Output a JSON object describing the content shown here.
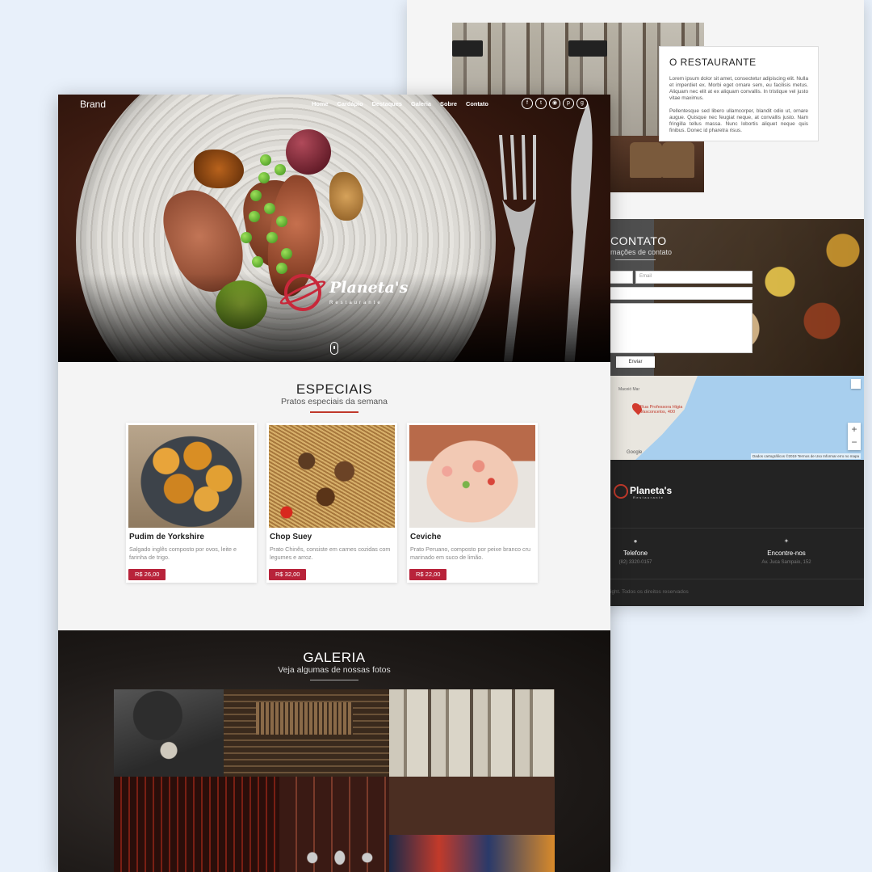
{
  "colors": {
    "accent": "#b8233a",
    "page_bg": "#e8f0fa",
    "dark": "#232323"
  },
  "hero": {
    "brand": "Brand",
    "nav": [
      "Home",
      "Cardápio",
      "Destaques",
      "Galeria",
      "Sobre",
      "Contato"
    ],
    "social_icons": [
      "facebook-icon",
      "twitter-icon",
      "instagram-icon",
      "pinterest-icon",
      "google-plus-icon"
    ],
    "logo_name": "Planeta's",
    "logo_tagline": "Restaurante"
  },
  "specials": {
    "title": "ESPECIAIS",
    "subtitle": "Pratos especiais da semana",
    "items": [
      {
        "name": "Pudim de Yorkshire",
        "desc": "Salgado inglês composto por ovos, leite e farinha de trigo.",
        "price": "R$ 26,00"
      },
      {
        "name": "Chop Suey",
        "desc": "Prato Chinês, consiste em carnes cozidas com legumes e arroz.",
        "price": "R$ 32,00"
      },
      {
        "name": "Ceviche",
        "desc": "Prato Peruano, composto por peixe branco cru marinado em suco de limão.",
        "price": "R$ 22,00"
      }
    ]
  },
  "gallery": {
    "title": "GALERIA",
    "subtitle": "Veja algumas de nossas fotos"
  },
  "restaurant": {
    "title": "O RESTAURANTE",
    "p1": "Lorem ipsum dolor sit amet, consectetur adipiscing elit. Nulla et imperdiet ex. Morbi eget ornare sem, eu facilisis metus. Aliquam nec elit at ex aliquam convallis. In tristique vel justo vitae maximus.",
    "p2": "Pellentesque sed libero ullamcorper, blandit odio ut, ornare augue. Quisque nec feugiat neque, at convallis justo. Nam fringilla tellus massa. Nunc lobortis aliquet neque quis finibus. Donec id pharetra risus."
  },
  "contact": {
    "title": "CONTATO",
    "subtitle": "mações de contato",
    "email_placeholder": "Email",
    "send_label": "Enviar"
  },
  "map": {
    "address": "Rua Professora Higia Vasconcelos, 400",
    "area_label": "Maceió Mar",
    "google": "Google",
    "copyright": "Dados cartográficos ©2019   Termos de Uso   Informar erro no mapa",
    "zoom_in": "+",
    "zoom_out": "−"
  },
  "footer": {
    "logo_name": "Planeta's",
    "logo_tagline": "Restaurante",
    "phone_label": "Telefone",
    "phone_value": "(82) 3320-0157",
    "location_label": "Encontre-nos",
    "location_value": "Av. Juca Sampaio, 152",
    "rights": "ight. Todos os direitos reservados"
  }
}
